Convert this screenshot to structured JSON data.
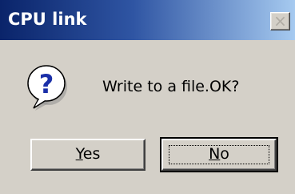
{
  "window": {
    "title": "CPU link",
    "close_glyph": "×"
  },
  "dialog": {
    "icon": "question-icon",
    "message": "Write to a file.OK?"
  },
  "buttons": {
    "yes": {
      "mnemonic": "Y",
      "rest": "es",
      "default": false
    },
    "no": {
      "mnemonic": "N",
      "rest": "o",
      "default": true
    }
  },
  "colors": {
    "title_gradient_start": "#0a246a",
    "title_gradient_end": "#a6caf0",
    "face": "#d4d0c8",
    "icon_blue": "#1a2fa8"
  }
}
